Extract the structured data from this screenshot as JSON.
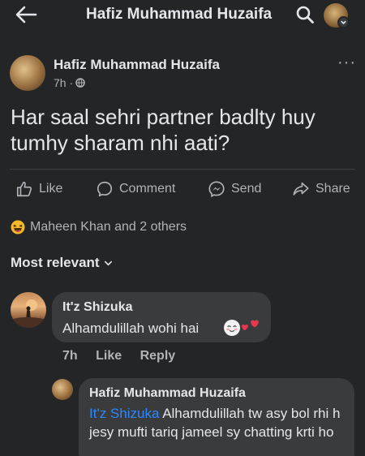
{
  "topbar": {
    "title": "Hafiz Muhammad Huzaifa"
  },
  "post": {
    "author": "Hafiz Muhammad Huzaifa",
    "time": "7h ·",
    "text": "Har saal sehri partner badlty huy tumhy sharam nhi aati?",
    "more": "···"
  },
  "actions": {
    "like": "Like",
    "comment": "Comment",
    "send": "Send",
    "share": "Share"
  },
  "reactions": {
    "text": "Maheen Khan and 2 others"
  },
  "sort": {
    "label": "Most relevant"
  },
  "comments": [
    {
      "author": "It'z Shizuka",
      "text": "Alhamdulillah wohi hai",
      "time": "7h",
      "like": "Like",
      "reply": "Reply"
    },
    {
      "author": "Hafiz Muhammad Huzaifa",
      "mention": "It'z Shizuka",
      "text": " Alhamdulillah tw asy bol rhi h jesy mufti tariq jameel sy chatting krti ho"
    }
  ],
  "colors": {
    "background": "#242526",
    "bubble": "#3a3b3c",
    "text": "#e4e6eb",
    "muted": "#b0b3b8",
    "link": "#2d88ff",
    "emoji": "#f7b928"
  }
}
